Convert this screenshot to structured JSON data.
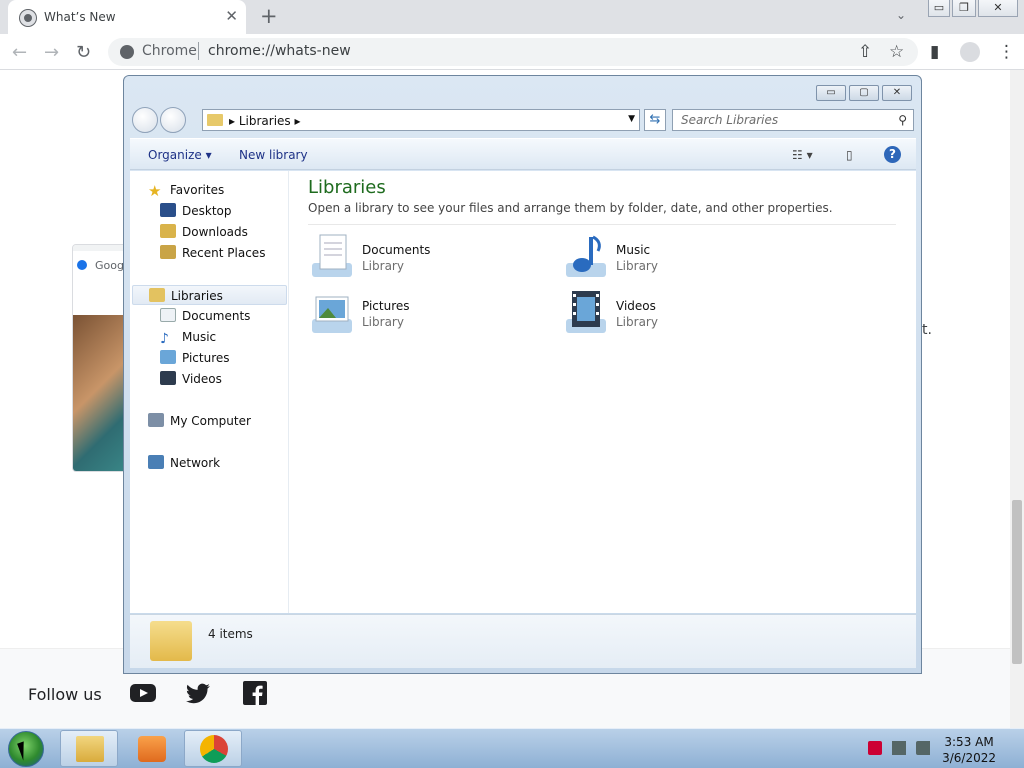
{
  "browser": {
    "tab_title": "What’s New",
    "tab_close": "✕",
    "new_tab": "+",
    "tab_list": "⌄",
    "omnibox_chip": "Chrome",
    "omnibox_url": "chrome://whats-new",
    "window_min": "▭",
    "window_restore": "❐",
    "window_close": "✕",
    "back": "←",
    "forward": "→",
    "reload": "↻",
    "share": "⇧",
    "bookmark": "☆",
    "sidepanel": "▮",
    "menu": "⋮"
  },
  "page": {
    "card_title": "Goog",
    "fragment_text": "t.",
    "follow_us": "Follow us"
  },
  "explorer": {
    "breadcrumb": "Libraries",
    "breadcrumb_arrow_left": "▸",
    "breadcrumb_arrow_right": "▸",
    "search_placeholder": "Search Libraries",
    "search_icon": "⚲",
    "organize": "Organize ▾",
    "new_library": "New library",
    "views": "☷ ▾",
    "preview": "▯",
    "help": "?",
    "title": "Libraries",
    "subtitle": "Open a library to see your files and arrange them by folder, date, and other properties.",
    "nav": {
      "favorites": "Favorites",
      "desktop": "Desktop",
      "downloads": "Downloads",
      "recent_places": "Recent Places",
      "libraries": "Libraries",
      "documents": "Documents",
      "music": "Music",
      "pictures": "Pictures",
      "videos": "Videos",
      "my_computer": "My Computer",
      "network": "Network"
    },
    "libraries": [
      {
        "name": "Documents",
        "type": "Library"
      },
      {
        "name": "Music",
        "type": "Library"
      },
      {
        "name": "Pictures",
        "type": "Library"
      },
      {
        "name": "Videos",
        "type": "Library"
      }
    ],
    "item_count": "4 items",
    "window_min": "▭",
    "window_max": "▢",
    "window_close": "✕"
  },
  "taskbar": {
    "time": "3:53 AM",
    "date": "3/6/2022"
  }
}
